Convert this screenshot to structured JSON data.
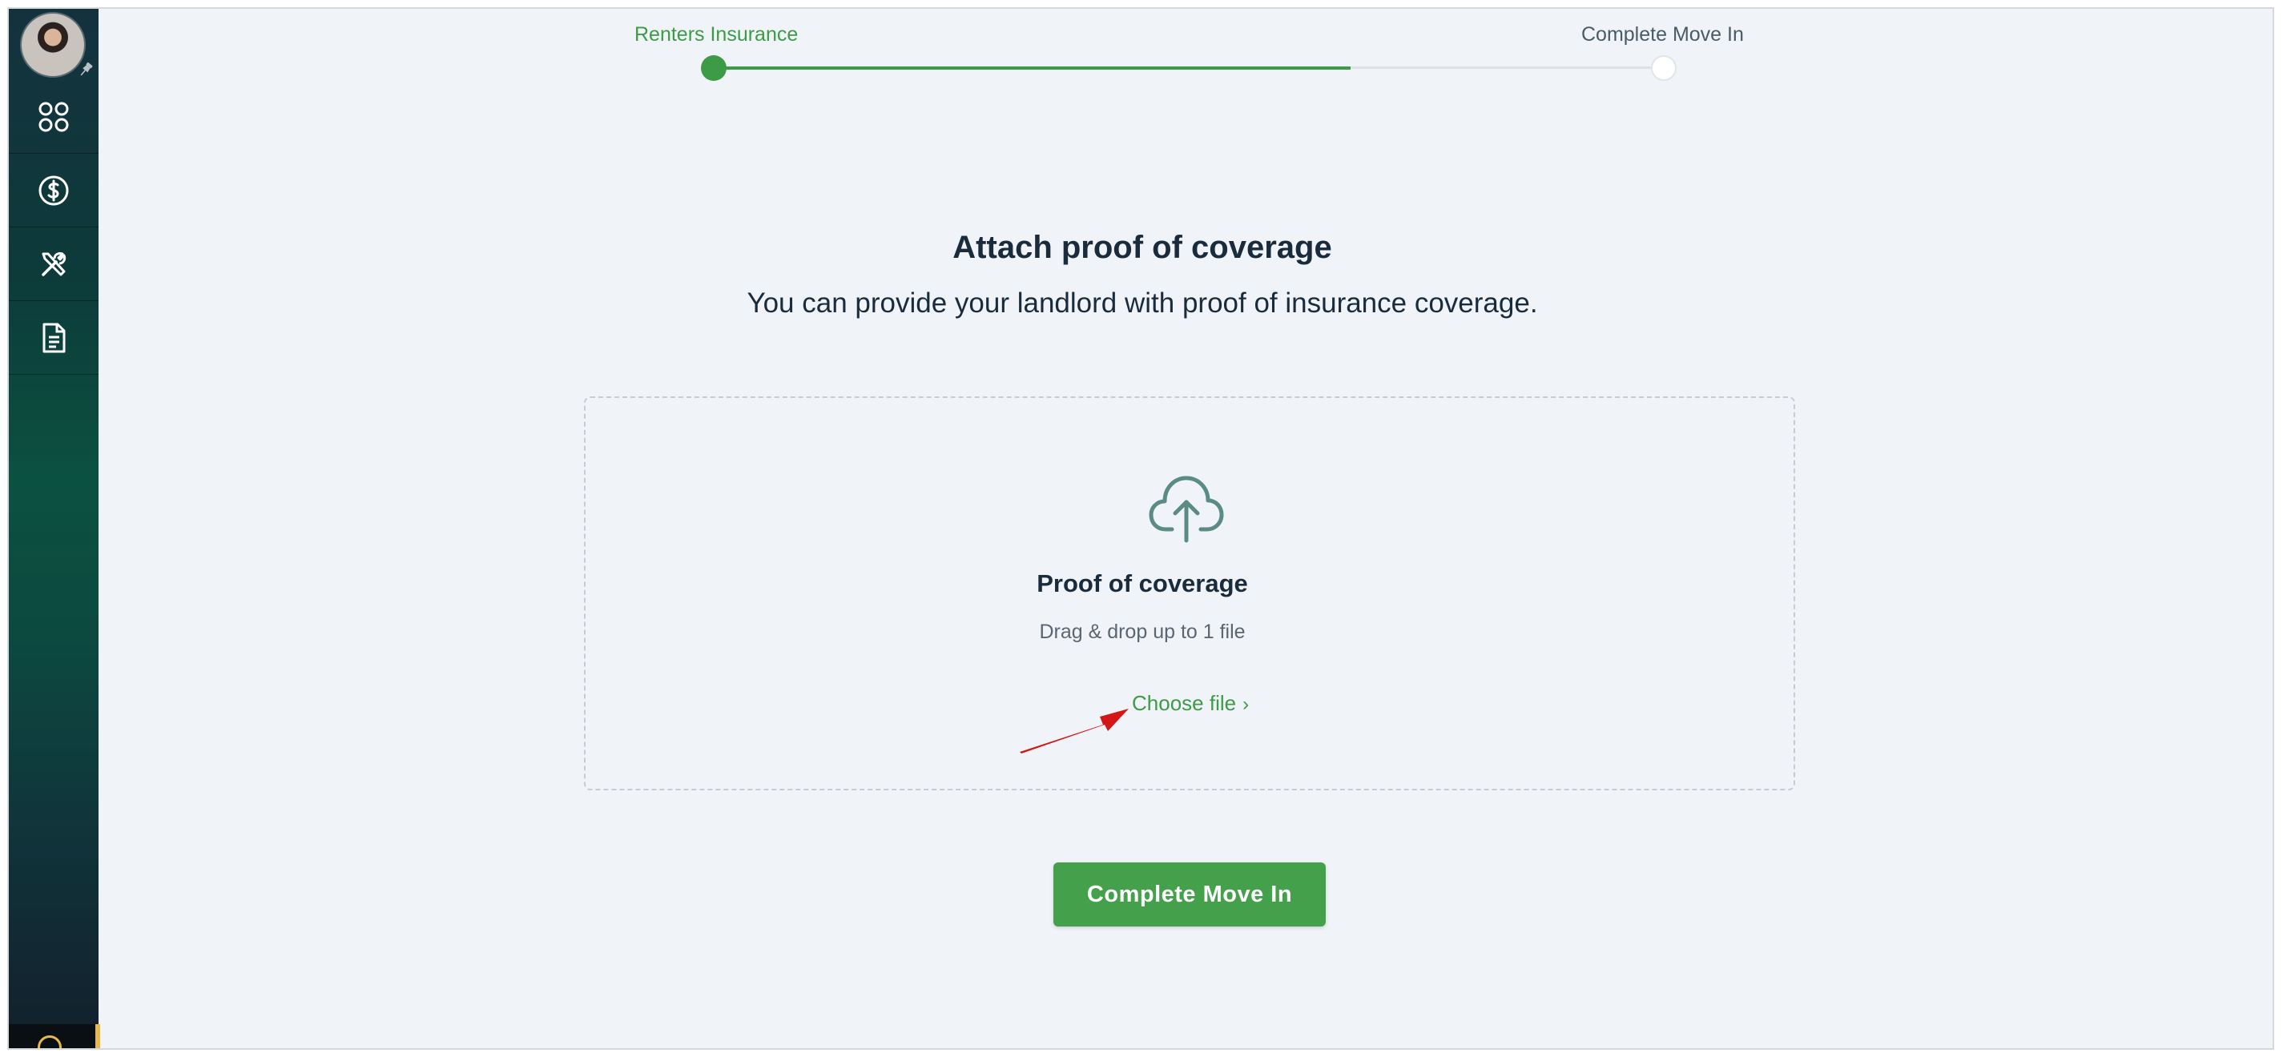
{
  "stepper": {
    "steps": [
      {
        "label": "Renters Insurance",
        "state": "active"
      },
      {
        "label": "Complete Move In",
        "state": "pending"
      }
    ],
    "progress_percent": 67
  },
  "sidebar": {
    "avatar_icon": "user-avatar",
    "pin_icon": "pin-icon",
    "items": [
      {
        "icon": "apps-grid-icon"
      },
      {
        "icon": "dollar-circle-icon"
      },
      {
        "icon": "tools-icon"
      },
      {
        "icon": "document-icon"
      }
    ]
  },
  "main": {
    "title": "Attach proof of coverage",
    "subtitle": "You can provide your landlord with proof of insurance coverage."
  },
  "upload": {
    "icon": "cloud-upload-icon",
    "title": "Proof of coverage",
    "hint": "Drag & drop up to 1 file",
    "choose_label": "Choose file",
    "choose_chevron": "›"
  },
  "actions": {
    "complete_label": "Complete Move In"
  },
  "colors": {
    "accent": "#3d9b47",
    "button": "#44a04b",
    "text": "#1a2b3c",
    "background": "#f0f4f8",
    "annotation_arrow": "#d41616"
  }
}
